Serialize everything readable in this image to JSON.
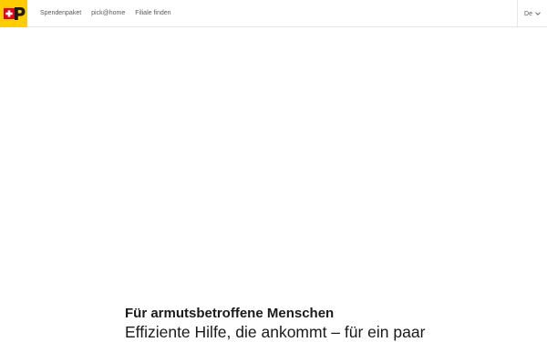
{
  "brand": {
    "logo_icon": "swiss-post-logo-icon",
    "accent_color": "#ffcc00",
    "cross_color": "#e2001a"
  },
  "nav": {
    "items": [
      {
        "label": "Spendenpaket"
      },
      {
        "label": "pick@home"
      },
      {
        "label": "Filiale finden"
      }
    ]
  },
  "language": {
    "selected": "De",
    "icon": "chevron-down-icon"
  },
  "hero": {
    "title": "Für armutsbetroffene Menschen",
    "subtitle": "Effiziente Hilfe, die ankommt – für ein paar"
  }
}
